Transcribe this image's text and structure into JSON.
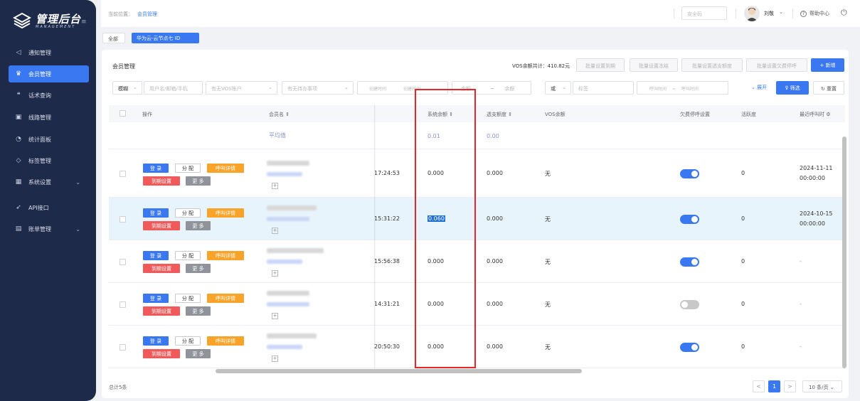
{
  "sidebar": {
    "logo_title": "管理后台",
    "logo_sub": "MANAGEMENT",
    "items": [
      {
        "label": "通知管理",
        "icon": "speaker-icon",
        "glyph": "◁",
        "active": false
      },
      {
        "label": "会员管理",
        "icon": "crown-icon",
        "glyph": "♛",
        "active": true
      },
      {
        "label": "话术查询",
        "icon": "quote-icon",
        "glyph": "❝",
        "active": false
      },
      {
        "label": "线路管理",
        "icon": "image-icon",
        "glyph": "▣",
        "active": false
      },
      {
        "label": "统计面板",
        "icon": "pie-chart-icon",
        "glyph": "◔",
        "active": false
      },
      {
        "label": "标签管理",
        "icon": "tag-icon",
        "glyph": "◇",
        "active": false
      },
      {
        "label": "系统设置",
        "icon": "grid-icon",
        "glyph": "▦",
        "active": false,
        "expandable": true
      },
      {
        "label": "API接口",
        "icon": "rocket-icon",
        "glyph": "➶",
        "active": false
      },
      {
        "label": "账单管理",
        "icon": "wallet-icon",
        "glyph": "▤",
        "active": false,
        "expandable": true
      }
    ]
  },
  "header": {
    "crumb_label": "当前位置：",
    "crumb_current": "会员管理",
    "safe_code_placeholder": "安全码",
    "user_name": "刘敬",
    "help": "帮助中心"
  },
  "tags": [
    "全部",
    "华为云-云节点七  ID"
  ],
  "card": {
    "title": "会员管理",
    "vos_total": "VOS余额共计：410.82元",
    "batch_buttons": [
      "批量设置到期",
      "批量设置冻结",
      "批量设置透支额度",
      "批量设置欠费停呼"
    ],
    "add_label": "+ 新增"
  },
  "filters": {
    "mode": "模糊",
    "user_placeholder": "用户名/邮箱/手机",
    "vos_account": "有无VOS账户",
    "todo": "有无待办事项",
    "created_start": "创建时间",
    "created_end": "创建时间",
    "amount_min": "金额",
    "amount_sep": "~",
    "amount_max": "余额",
    "logic": "或",
    "tag": "标签",
    "call_start": "呼叫时间",
    "call_sep": "~",
    "call_end": "呼叫时间",
    "expand": "展开",
    "filter_label": "筛选",
    "reset_label": "重置"
  },
  "table": {
    "headers": {
      "action": "操作",
      "member": "会员名",
      "balance": "系统余额",
      "overdraft": "透支额度",
      "vos_balance": "VOS余额",
      "arrears_stop": "欠费停呼设置",
      "activity": "活跃度",
      "last_call": "最近呼叫时"
    },
    "avg_row": {
      "member": "平均值",
      "balance": "0.01",
      "overdraft": "0.00"
    },
    "buttons": {
      "login": "登 录",
      "assign": "分 配",
      "call_detail": "呼叫详情",
      "expire": "到期设置",
      "more": "更 多"
    },
    "rows": [
      {
        "time": "17:24:53",
        "balance": "0.000",
        "overdraft": "0.000",
        "vos": "无",
        "stop": true,
        "activity": "0",
        "last_call_date": "2024-11-11",
        "last_call_time": "00:00:00"
      },
      {
        "time": "15:31:22",
        "balance": "0.060",
        "overdraft": "0.000",
        "vos": "无",
        "stop": true,
        "activity": "0",
        "last_call_date": "2024-10-15",
        "last_call_time": "00:00:00"
      },
      {
        "time": "15:56:38",
        "balance": "0.000",
        "overdraft": "0.000",
        "vos": "无",
        "stop": true,
        "activity": "0",
        "last_call_date": "-",
        "last_call_time": ""
      },
      {
        "time": "14:31:21",
        "balance": "0.000",
        "overdraft": "0.000",
        "vos": "无",
        "stop": false,
        "activity": "0",
        "last_call_date": "-",
        "last_call_time": ""
      },
      {
        "time": "20:50:30",
        "balance": "0.000",
        "overdraft": "0.000",
        "vos": "无",
        "stop": true,
        "activity": "0",
        "last_call_date": "-",
        "last_call_time": ""
      }
    ]
  },
  "footer": {
    "total": "总计5条",
    "page": "1",
    "prev": "<",
    "next": ">",
    "page_size": "10 条/页"
  },
  "colors": {
    "accent": "#3a78f2",
    "sidebar_bg": "#1e2a4a",
    "highlight_box": "#e8262a",
    "warning": "#f8a42a",
    "danger": "#f05a5a"
  }
}
